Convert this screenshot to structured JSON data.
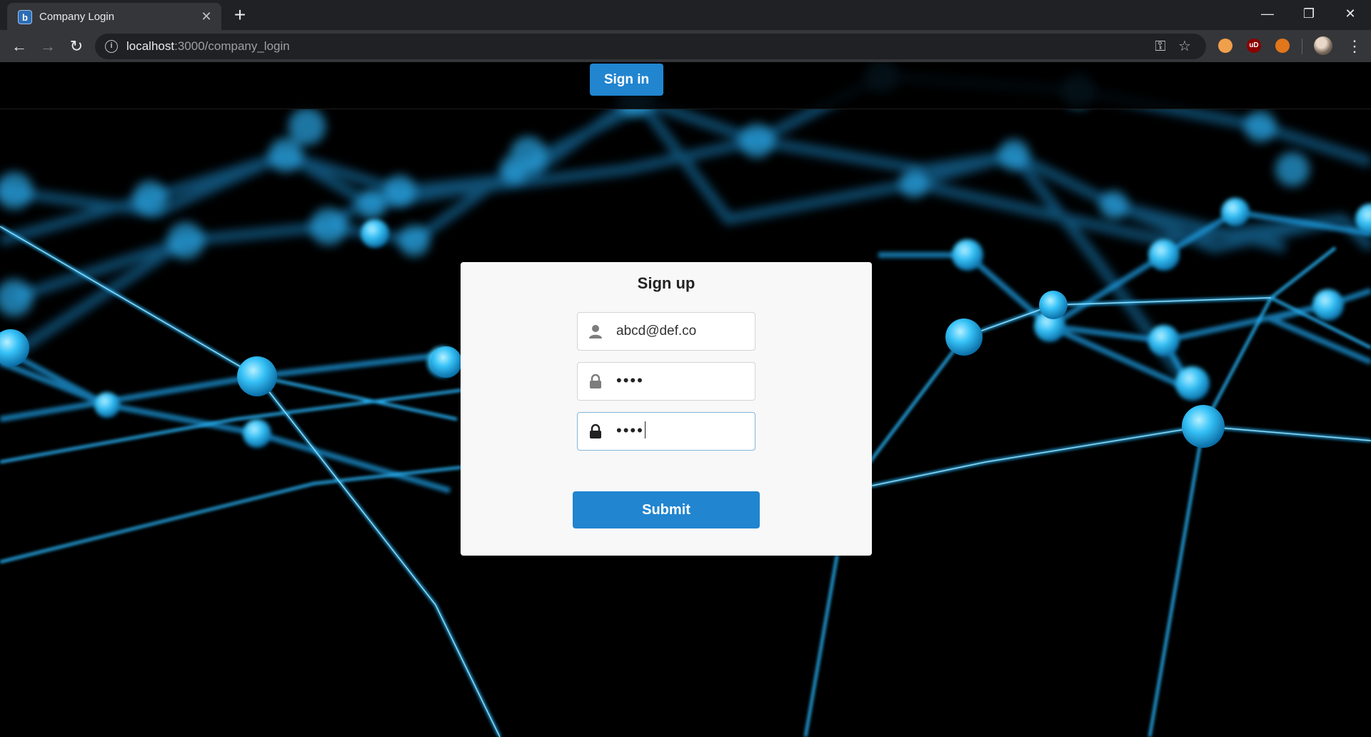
{
  "browser": {
    "tab_title": "Company Login",
    "tab_favicon_letter": "b",
    "tab_close": "✕",
    "new_tab": "+",
    "window_controls": {
      "minimize": "—",
      "restore": "❐",
      "close": "✕"
    },
    "nav": {
      "back": "←",
      "forward": "→",
      "reload": "↻"
    },
    "url_host": "localhost",
    "url_path": ":3000/company_login",
    "omnibox_icons": {
      "key": "⚿",
      "star": "☆"
    },
    "extensions": [
      {
        "name": "extension-orange-icon",
        "color": "#f0a04b",
        "label": ""
      },
      {
        "name": "ublock-icon",
        "color": "#8b0000",
        "label": "uD"
      },
      {
        "name": "metamask-fox-icon",
        "color": "#e2761b",
        "label": ""
      }
    ],
    "menu": "⋮"
  },
  "page": {
    "nav": {
      "signin_label": "Sign in"
    },
    "form": {
      "title": "Sign up",
      "email_value": "abcd@def.co",
      "password_mask": "••••",
      "confirm_password_mask": "••••",
      "submit_label": "Submit"
    },
    "colors": {
      "primary": "#2185d0",
      "network": "#29b6f6"
    }
  }
}
